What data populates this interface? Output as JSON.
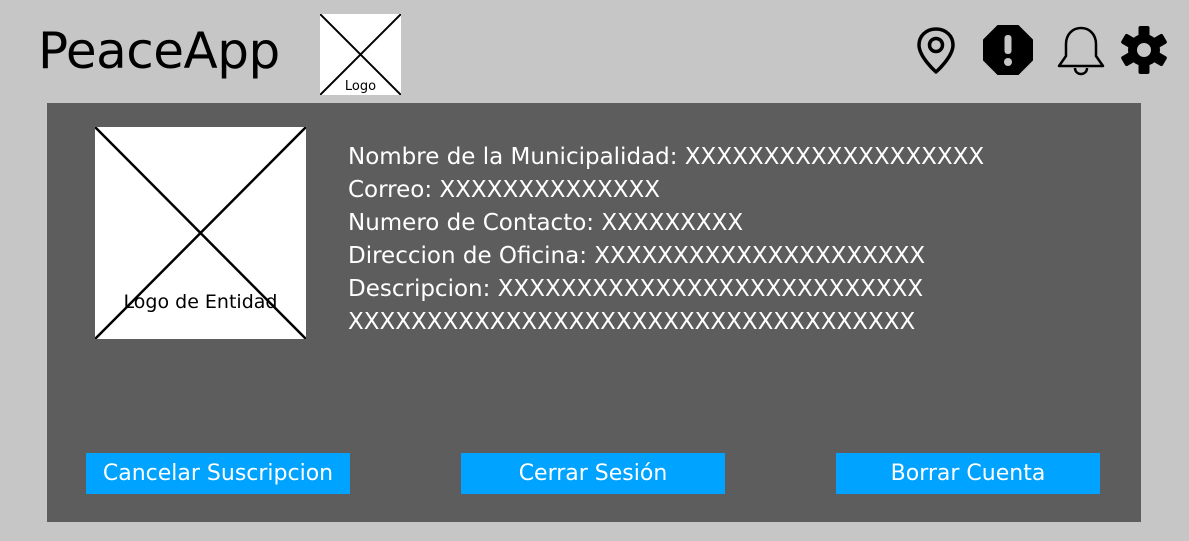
{
  "header": {
    "title": "PeaceApp",
    "logo_label": "Logo",
    "icons": [
      "location-pin-icon",
      "alert-octagon-icon",
      "bell-icon",
      "gear-icon"
    ]
  },
  "profile": {
    "entity_logo_label": "Logo de Entidad",
    "fields": [
      "Nombre de la Municipalidad: XXXXXXXXXXXXXXXXXXX",
      "Correo: XXXXXXXXXXXXXX",
      "Numero de Contacto: XXXXXXXXX",
      "Direccion de Oficina: XXXXXXXXXXXXXXXXXXXXX",
      "Descripcion: XXXXXXXXXXXXXXXXXXXXXXXXXXX",
      "XXXXXXXXXXXXXXXXXXXXXXXXXXXXXXXXXXXX"
    ]
  },
  "actions": {
    "cancel_subscription": "Cancelar Suscripcion",
    "logout": "Cerrar Sesión",
    "delete_account": "Borrar Cuenta"
  },
  "colors": {
    "background": "#c6c6c6",
    "panel": "#5d5d5d",
    "button": "#00a3ff"
  }
}
